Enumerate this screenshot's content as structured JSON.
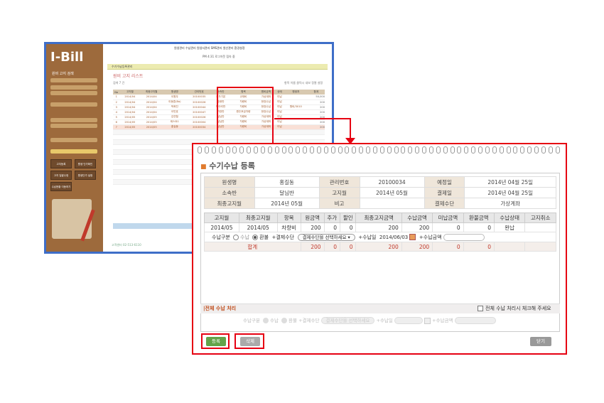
{
  "bg_app": {
    "logo": "I-Bill",
    "sidebar_title": "원비 고지 검색",
    "sidebar_btn1": "고지등록",
    "sidebar_btn2": "원생 단가확인",
    "sidebar_btn3": "고지 일괄수정",
    "sidebar_btn4": "원생단가 설정",
    "sidebar_btn5": "수납현황 이동하기",
    "topnav": "원생관리  수납관리  원생서관리  SMS관리  원산관리  환경설정",
    "subnav": "PM 4:31  로그아웃  접속 중",
    "tab": "수기수납등록관리",
    "title": "원비 고지 리스트",
    "count_label": "검색 7 건",
    "hint": "항목 이름 클릭시 내보 정렬 설정",
    "headers": [
      "No",
      "고지월",
      "최종고지월",
      "원생명",
      "관리번호",
      "소속반",
      "항목",
      "원비금액",
      "상태",
      "원생처",
      "합계"
    ],
    "rows": [
      [
        "1",
        "2014/04",
        "2014/04",
        "이원우",
        "20100035",
        "주차기본",
        "교재비",
        "가상계좌",
        "미납",
        "",
        "50,000"
      ],
      [
        "2",
        "2014/04",
        "2014/04",
        "이동훈(Bo)",
        "20100026",
        "호랑반",
        "차량비",
        "현장수납",
        "미납",
        "",
        "200"
      ],
      [
        "3",
        "2014/04",
        "2014/04",
        "박희진",
        "20100044",
        "병아리반",
        "차량비",
        "현장수납",
        "미납",
        "원비/3010",
        "200"
      ],
      [
        "4",
        "2014/04",
        "2014/04",
        "이민호",
        "20100047",
        "가장반",
        "원주후금차량",
        "현장수납",
        "미납",
        "",
        "200"
      ],
      [
        "5",
        "2014/05",
        "2014/05",
        "김연철",
        "20100026",
        "달님반",
        "차량비",
        "가상계좌",
        "미납",
        "",
        "200"
      ],
      [
        "6",
        "2014/05",
        "2014/05",
        "테스트1",
        "20100004",
        "달님반",
        "차량비",
        "가상계좌",
        "미납",
        "",
        "200"
      ],
      [
        "7",
        "2014/05",
        "2014/05",
        "홍길동",
        "20100034",
        "달님반",
        "차량비",
        "가상계좌",
        "미납",
        "",
        "200"
      ]
    ],
    "footer": "합계",
    "bottom": "고객센터 02-513-6110"
  },
  "dialog": {
    "title": "수기수납 등록",
    "info": {
      "name_label": "원생명",
      "name": "홍길동",
      "mgmt_label": "관리번호",
      "mgmt": "20100034",
      "due_label": "예정일",
      "due": "2014년 04월 25일",
      "class_label": "소속반",
      "class": "달님반",
      "month_label": "고지월",
      "month": "2014년 05월",
      "paydate_label": "결제일",
      "paydate": "2014년 04월 25일",
      "last_label": "최종고지월",
      "last": "2014년 05월",
      "note_label": "비고",
      "note": "",
      "method_label": "결제수단",
      "method": "가상계좌"
    },
    "pay_headers": [
      "고지월",
      "최종고지월",
      "항목",
      "원금액",
      "추가",
      "할인",
      "최종고지금액",
      "수납금액",
      "미납금액",
      "환불금액",
      "수납상태",
      "고지취소"
    ],
    "pay_row": [
      "2014/05",
      "2014/05",
      "차량비",
      "200",
      "0",
      "0",
      "200",
      "200",
      "0",
      "0",
      "완납",
      ""
    ],
    "opt": {
      "kind_label": "수납구분",
      "opt1": "수납",
      "opt2": "환불",
      "method_label": "+결제수단",
      "method_select": "결제수단을 선택하세요",
      "date_label": "+수납일",
      "date": "2014/06/03",
      "amount_label": "+수납금액"
    },
    "total": {
      "label": "합계",
      "v1": "200",
      "v2": "0",
      "v3": "0",
      "v4": "200",
      "v5": "200",
      "v6": "0",
      "v7": "0"
    },
    "bulk_title": "|전체 수납 처리",
    "bulk_check": "전체 수납 처리시 체크해 주세요",
    "bulk_row": {
      "kind": "수납구분",
      "opt1": "수납",
      "opt2": "환불",
      "method": "+결제수단",
      "select": "결제수단을 선택하세요",
      "date": "+수납일",
      "amount": "+수납금액"
    },
    "btn_register": "등록",
    "btn_delete": "삭제",
    "btn_close": "닫기"
  },
  "colors": {
    "highlight": "#e60012",
    "accent": "#e07b2e",
    "sidebar": "#9d6a3c",
    "register": "#63a34a"
  }
}
